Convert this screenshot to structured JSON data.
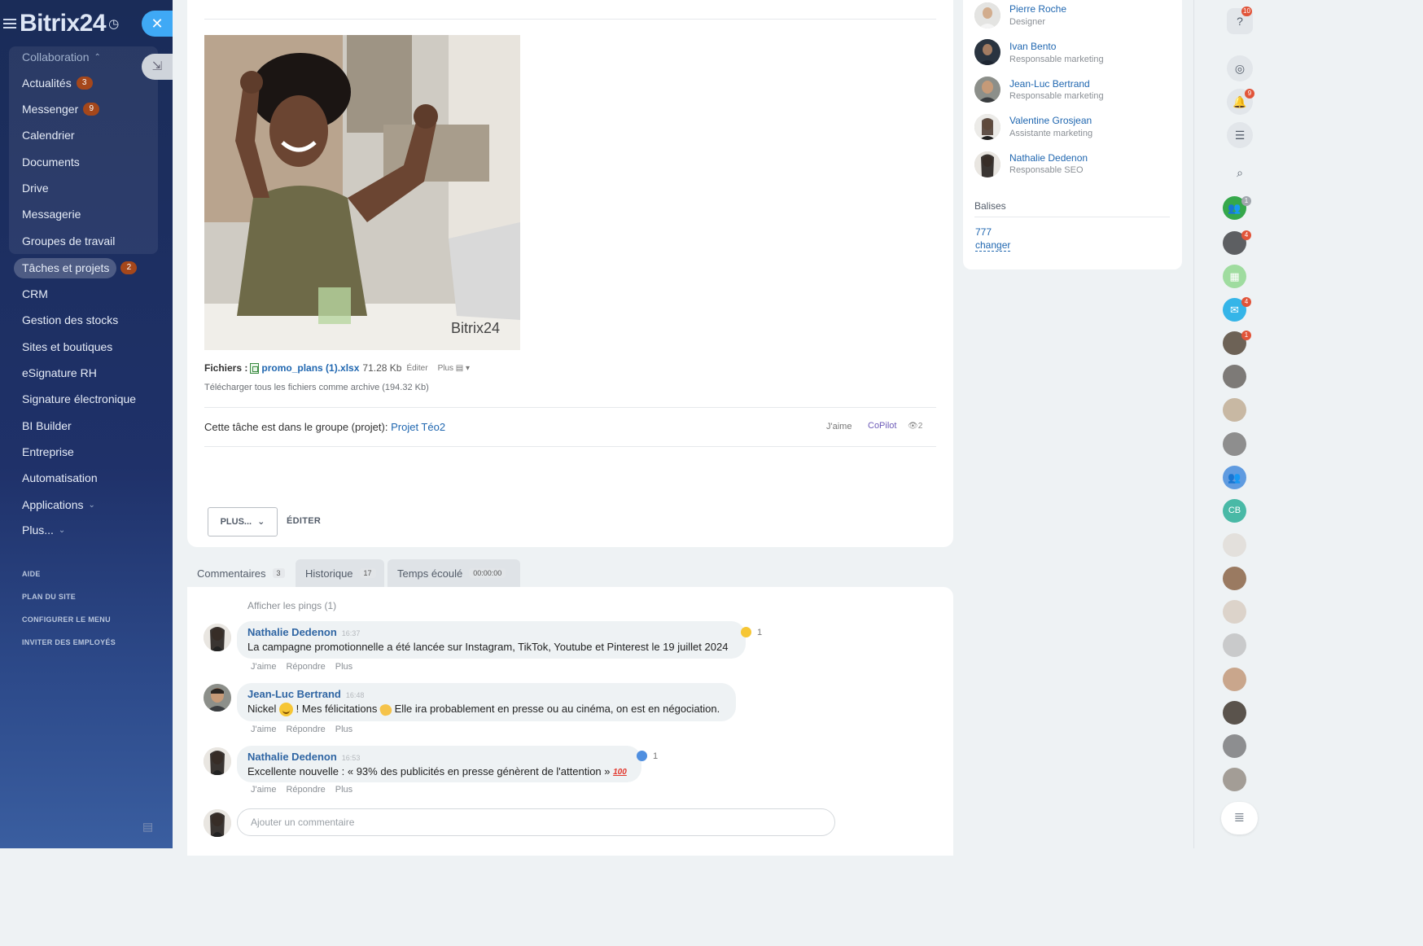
{
  "sidebar": {
    "logo": "Bitrix24",
    "items": [
      {
        "label": "Collaboration",
        "badge": ""
      },
      {
        "label": "Actualités",
        "badge": "3"
      },
      {
        "label": "Messenger",
        "badge": "9"
      },
      {
        "label": "Calendrier",
        "badge": ""
      },
      {
        "label": "Documents",
        "badge": ""
      },
      {
        "label": "Drive",
        "badge": ""
      },
      {
        "label": "Messagerie",
        "badge": ""
      },
      {
        "label": "Groupes de travail",
        "badge": ""
      },
      {
        "label": "Tâches et projets",
        "badge": "2"
      },
      {
        "label": "CRM",
        "badge": ""
      },
      {
        "label": "Gestion des stocks",
        "badge": ""
      },
      {
        "label": "Sites et boutiques",
        "badge": ""
      },
      {
        "label": "eSignature RH",
        "badge": ""
      },
      {
        "label": "Signature électronique",
        "badge": ""
      },
      {
        "label": "BI Builder",
        "badge": ""
      },
      {
        "label": "Entreprise",
        "badge": ""
      },
      {
        "label": "Automatisation",
        "badge": ""
      },
      {
        "label": "Applications",
        "badge": ""
      },
      {
        "label": "Plus...",
        "badge": ""
      }
    ],
    "footer": [
      "AIDE",
      "PLAN DU SITE",
      "CONFIGURER LE MENU",
      "INVITER DES EMPLOYÉS"
    ]
  },
  "task": {
    "image_watermark": "Bitrix24",
    "files_label": "Fichiers :",
    "file_name": "promo_plans (1).xlsx",
    "file_size": "71.28 Kb",
    "file_edit": "Éditer",
    "file_more": "Plus",
    "download_all": "Télécharger tous les fichiers comme archive (194.32 Kb)",
    "group_text": "Cette tâche est dans le groupe (projet):",
    "group_link": "Projet Téo2",
    "like": "J'aime",
    "copilot": "CoPilot",
    "views": "2",
    "plus_button": "PLUS...",
    "edit_button": "ÉDITER"
  },
  "tabs": [
    {
      "label": "Commentaires",
      "count": "3"
    },
    {
      "label": "Historique",
      "count": "17"
    },
    {
      "label": "Temps écoulé",
      "count": "00:00:00"
    }
  ],
  "comments": {
    "show_pings": "Afficher les pings (1)",
    "items": [
      {
        "author": "Nathalie Dedenon",
        "time": "16:37",
        "text": "La campagne promotionnelle a été lancée sur Instagram, TikTok, Youtube et Pinterest le 19 juillet 2024",
        "reaction_count": "1"
      },
      {
        "author": "Jean-Luc Bertrand",
        "time": "16:48",
        "text_a": "Nickel",
        "text_b": "! Mes félicitations",
        "text_c": "Elle ira probablement en presse ou au cinéma, on est en négociation."
      },
      {
        "author": "Nathalie Dedenon",
        "time": "16:53",
        "text": "Excellente nouvelle : « 93% des publicités en presse génèrent de l'attention »",
        "emoji_100": "100",
        "reaction_count": "1"
      }
    ],
    "actions": {
      "like": "J'aime",
      "reply": "Répondre",
      "more": "Plus"
    },
    "add_placeholder": "Ajouter un commentaire"
  },
  "people": [
    {
      "name": "Pierre Roche",
      "role": "Designer"
    },
    {
      "name": "Ivan Bento",
      "role": "Responsable marketing"
    },
    {
      "name": "Jean-Luc Bertrand",
      "role": "Responsable marketing"
    },
    {
      "name": "Valentine Grosjean",
      "role": "Assistante marketing"
    },
    {
      "name": "Nathalie Dedenon",
      "role": "Responsable SEO"
    }
  ],
  "tags": {
    "title": "Balises",
    "value": "777",
    "change": "changer"
  },
  "rightbar": {
    "help_badge": "10",
    "bell_badge": "9",
    "avatar_badges": [
      "1",
      "4",
      "",
      "4",
      "1"
    ],
    "cb_initials": "CB"
  }
}
